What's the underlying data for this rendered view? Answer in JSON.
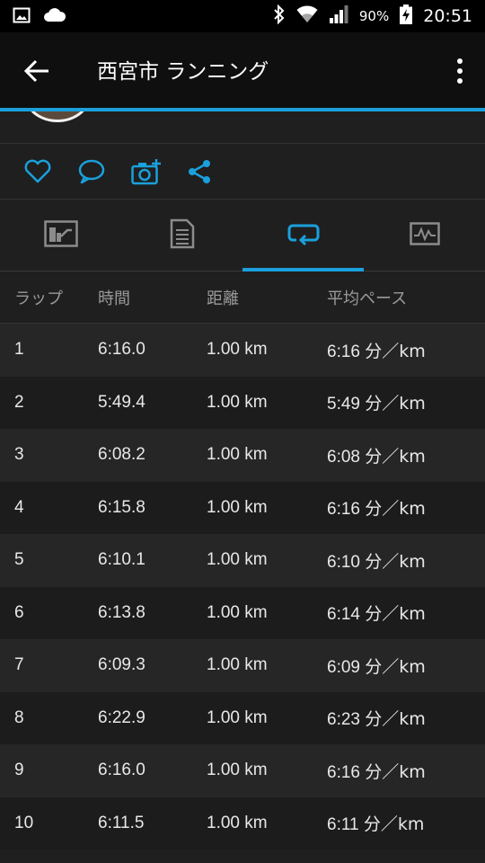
{
  "status_bar": {
    "battery_percent": "90%",
    "time": "20:51",
    "icons": [
      "image-icon",
      "cloud-icon",
      "bluetooth-icon",
      "wifi-icon",
      "signal-icon",
      "battery-charging-icon"
    ]
  },
  "app_bar": {
    "title": "西宮市 ランニング",
    "icons": [
      "back-arrow-icon",
      "more-vert-icon"
    ]
  },
  "actions": [
    "like-heart-icon",
    "comment-icon",
    "add-photo-icon",
    "share-icon"
  ],
  "tabs": [
    {
      "name": "overview",
      "icon": "chart-summary-icon",
      "selected": false
    },
    {
      "name": "details",
      "icon": "document-icon",
      "selected": false
    },
    {
      "name": "laps",
      "icon": "laps-loop-icon",
      "selected": true
    },
    {
      "name": "graphs",
      "icon": "activity-graph-icon",
      "selected": false
    }
  ],
  "accent_color": "#1aa0dc",
  "laps_table": {
    "headers": {
      "lap": "ラップ",
      "time": "時間",
      "distance": "距離",
      "avg_pace": "平均ペース"
    },
    "rows": [
      {
        "lap": "1",
        "time": "6:16.0",
        "distance": "1.00 km",
        "pace": "6:16",
        "pace_unit": "分／km"
      },
      {
        "lap": "2",
        "time": "5:49.4",
        "distance": "1.00 km",
        "pace": "5:49",
        "pace_unit": "分／km"
      },
      {
        "lap": "3",
        "time": "6:08.2",
        "distance": "1.00 km",
        "pace": "6:08",
        "pace_unit": "分／km"
      },
      {
        "lap": "4",
        "time": "6:15.8",
        "distance": "1.00 km",
        "pace": "6:16",
        "pace_unit": "分／km"
      },
      {
        "lap": "5",
        "time": "6:10.1",
        "distance": "1.00 km",
        "pace": "6:10",
        "pace_unit": "分／km"
      },
      {
        "lap": "6",
        "time": "6:13.8",
        "distance": "1.00 km",
        "pace": "6:14",
        "pace_unit": "分／km"
      },
      {
        "lap": "7",
        "time": "6:09.3",
        "distance": "1.00 km",
        "pace": "6:09",
        "pace_unit": "分／km"
      },
      {
        "lap": "8",
        "time": "6:22.9",
        "distance": "1.00 km",
        "pace": "6:23",
        "pace_unit": "分／km"
      },
      {
        "lap": "9",
        "time": "6:16.0",
        "distance": "1.00 km",
        "pace": "6:16",
        "pace_unit": "分／km"
      },
      {
        "lap": "10",
        "time": "6:11.5",
        "distance": "1.00 km",
        "pace": "6:11",
        "pace_unit": "分／km"
      }
    ]
  }
}
